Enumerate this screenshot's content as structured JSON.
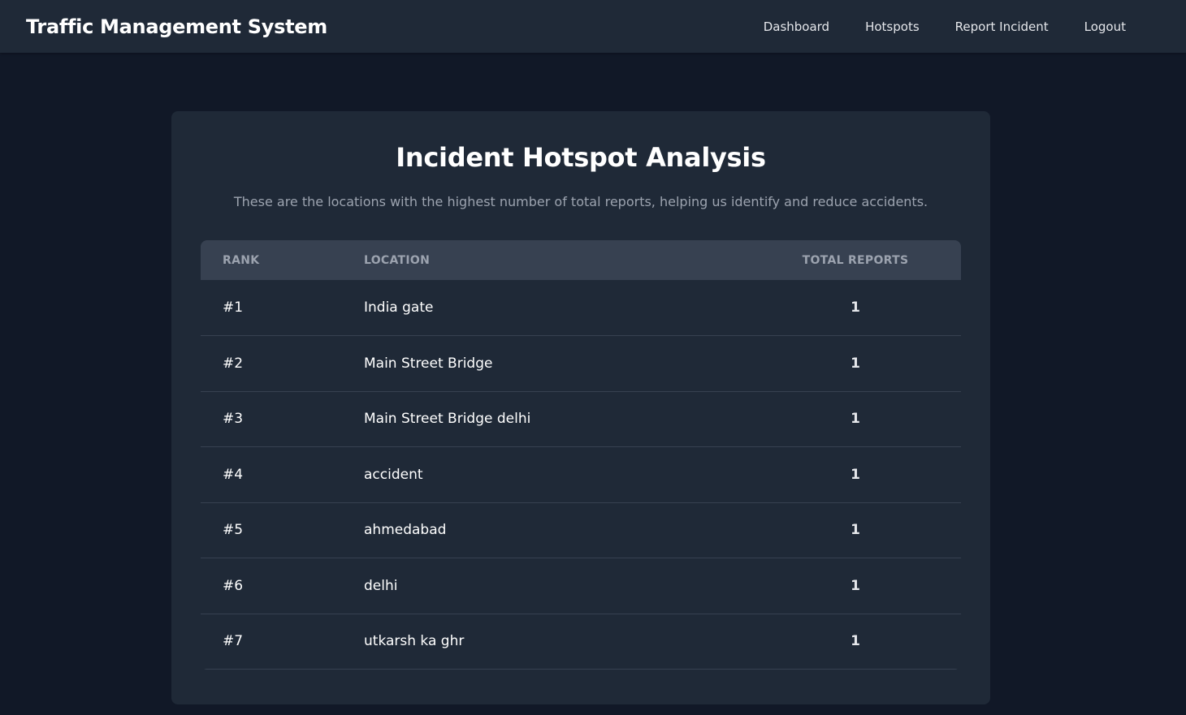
{
  "nav": {
    "title": "Traffic Management System",
    "links": [
      "Dashboard",
      "Hotspots",
      "Report Incident",
      "Logout"
    ]
  },
  "main": {
    "title": "Incident Hotspot Analysis",
    "subtitle": "These are the locations with the highest number of total reports, helping us identify and reduce accidents.",
    "table": {
      "headers": [
        "RANK",
        "LOCATION",
        "TOTAL REPORTS"
      ],
      "rows": [
        {
          "rank": "#1",
          "location": "India gate",
          "total": "1"
        },
        {
          "rank": "#2",
          "location": "Main Street Bridge",
          "total": "1"
        },
        {
          "rank": "#3",
          "location": "Main Street Bridge delhi",
          "total": "1"
        },
        {
          "rank": "#4",
          "location": "accident",
          "total": "1"
        },
        {
          "rank": "#5",
          "location": "ahmedabad",
          "total": "1"
        },
        {
          "rank": "#6",
          "location": "delhi",
          "total": "1"
        },
        {
          "rank": "#7",
          "location": "utkarsh ka ghr",
          "total": "1"
        }
      ]
    }
  }
}
